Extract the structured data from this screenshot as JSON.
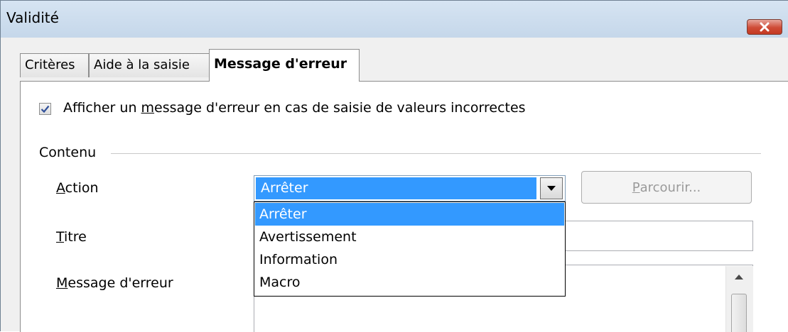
{
  "window": {
    "title": "Validité"
  },
  "tabs": [
    {
      "label": "Critères"
    },
    {
      "label": "Aide à la saisie"
    },
    {
      "label": "Message d'erreur"
    }
  ],
  "checkbox": {
    "checked": true,
    "label_before": "Afficher un ",
    "label_mnemonic": "m",
    "label_after": "essage d'erreur en cas de saisie de valeurs incorrectes"
  },
  "content": {
    "section_label": "Contenu",
    "action": {
      "label_mnemonic": "A",
      "label_rest": "ction",
      "selected": "Arrêter",
      "browse_mnemonic": "P",
      "browse_rest": "arcourir..."
    },
    "title_field": {
      "label_mnemonic": "T",
      "label_rest": "itre",
      "value": ""
    },
    "message_field": {
      "label_mnemonic": "M",
      "label_rest": "essage d'erreur",
      "value": ""
    }
  },
  "dropdown": {
    "options": [
      "Arrêter",
      "Avertissement",
      "Information",
      "Macro"
    ],
    "highlighted_index": 0
  },
  "colors": {
    "selection": "#3399ff",
    "close_button": "#c43a22"
  }
}
